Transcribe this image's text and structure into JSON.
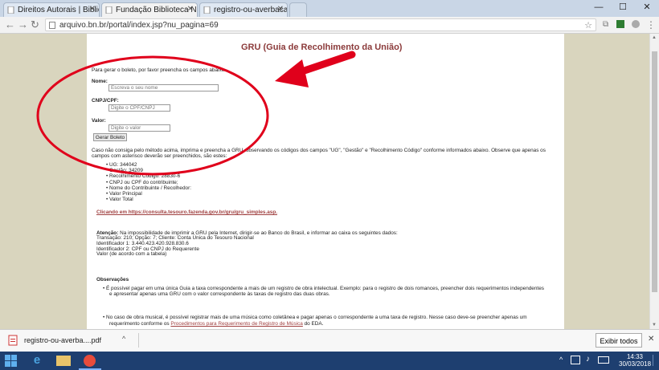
{
  "tabs": [
    {
      "label": "Direitos Autorais | Bibliot",
      "active": false
    },
    {
      "label": "Fundação Biblioteca Nac",
      "active": true
    },
    {
      "label": "registro-ou-averbacao-5",
      "active": false
    }
  ],
  "address": {
    "url": "arquivo.bn.br/portal/index.jsp?nu_pagina=69"
  },
  "page": {
    "title": "GRU (Guia de Recolhimento da União)",
    "intro": "Para gerar o boleto, por favor preencha os campos abaixo.",
    "name_label": "Nome:",
    "name_placeholder": "Escreva o seu nome",
    "cnpj_label": "CNPJ/CPF:",
    "cnpj_placeholder": "Digite o CPF/CNPJ",
    "valor_label": "Valor:",
    "valor_placeholder": "Digite o valor",
    "submit_label": "Gerar Boleto",
    "fallback_line1": "Caso não consiga pelo método acima, imprima e preencha a GRU, observando os códigos dos campos \"UG\", \"Gestão\" e \"Recolhimento Código\" conforme informados abaixo. Observe que apenas os",
    "fallback_line2": "campos com asterisco deverão ser preenchidos, são estes:",
    "fields_list": [
      "UG: 344042",
      "Gestão: 34209",
      "Recolhimento Código: 28830-6",
      "CNPJ ou CPF do contribuinte;",
      "Nome do Contribuinte / Recolhedor:",
      "Valor Principal",
      "Valor Total"
    ],
    "tesouro_link": "Clicando em https://consulta.tesouro.fazenda.gov.br/gru/gru_simples.asp.",
    "atencao_label": "Atenção:",
    "atencao_text": " Na impossibilidade de imprimir a GRU pela Internet, dirigir-se ao Banco do Brasil, e informar ao caixa os seguintes dados:",
    "atencao_lines": [
      "Transação: 210; Opção: 7; Cliente: Conta Única do Tesouro Nacional",
      "Identificador 1: 3.440.423.420.928.830.6",
      "Identificador 2: CPF ou CNPJ do Requerente",
      "Valor (de acordo com a tabela)"
    ],
    "observacoes_label": "Observações",
    "obs1_line1": "É possível pagar em uma única Guia a taxa correspondente a mais de um registro de obra intelectual. Exemplo: para o registro de dois romances, preencher dois requerimentos independentes",
    "obs1_line2": "e apresentar apenas uma GRU com o valor correspondente às taxas de registro das duas obras.",
    "obs2_line1": "No caso de obra musical, é possível registrar mais de uma música como coletânea e pagar apenas o correspondente a uma taxa de registro.  Nesse caso deve-se preencher apenas um",
    "obs2_line2_pre": "requerimento conforme os ",
    "obs2_link": "Procedimentos para Requerimento de Registro de Música",
    "obs2_line2_post": " do EDA."
  },
  "download": {
    "filename": "registro-ou-averba....pdf",
    "show_all": "Exibir todos"
  },
  "taskbar": {
    "time": "14:33",
    "date": "30/03/2018"
  },
  "colors": {
    "annotation": "#e0001b",
    "title": "#8b3a3a",
    "page_bg": "#d9d5be"
  }
}
